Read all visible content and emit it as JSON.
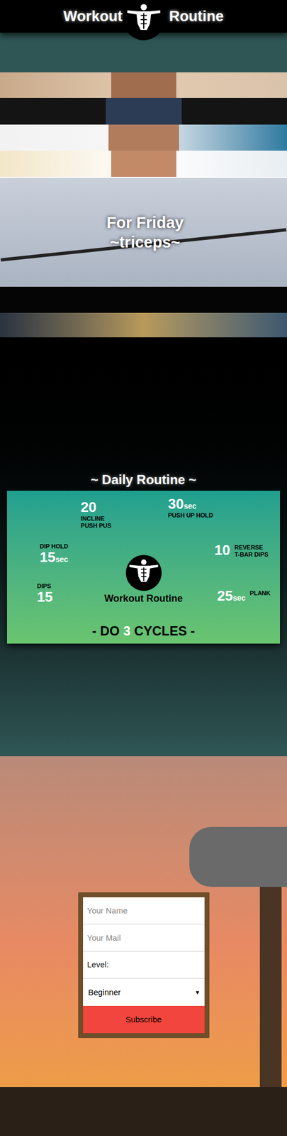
{
  "header": {
    "title_left": "Workout",
    "title_right": "Routine"
  },
  "hero": {
    "line1": "For Friday",
    "line2": "~triceps~"
  },
  "routine": {
    "title": "~ Daily Routine ~",
    "brand": "Workout Routine",
    "footer_pre": "- DO ",
    "cycles": "3",
    "footer_post": " CYCLES -",
    "steps": [
      {
        "value": "20",
        "unit": "",
        "label": "INCLINE\nPUSH PUS",
        "kind": "number-top"
      },
      {
        "value": "30",
        "unit": "sec",
        "label": "PUSH UP HOLD",
        "kind": "number-top"
      },
      {
        "value": "10",
        "unit": "",
        "label": "REVERSE\nT-BAR DIPS",
        "kind": "number-side"
      },
      {
        "value": "25",
        "unit": "sec",
        "label": "PLANK",
        "kind": "number-side"
      },
      {
        "value": "15",
        "unit": "",
        "label": "DIPS",
        "kind": "label-top"
      },
      {
        "value": "15",
        "unit": "sec",
        "label": "DIP HOLD",
        "kind": "label-top"
      }
    ]
  },
  "form": {
    "name_placeholder": "Your Name",
    "mail_placeholder": "Your Mail",
    "level_label": "Level:",
    "level_value": "Beginner",
    "select_arrow": "▾",
    "button": "Subscribe"
  }
}
